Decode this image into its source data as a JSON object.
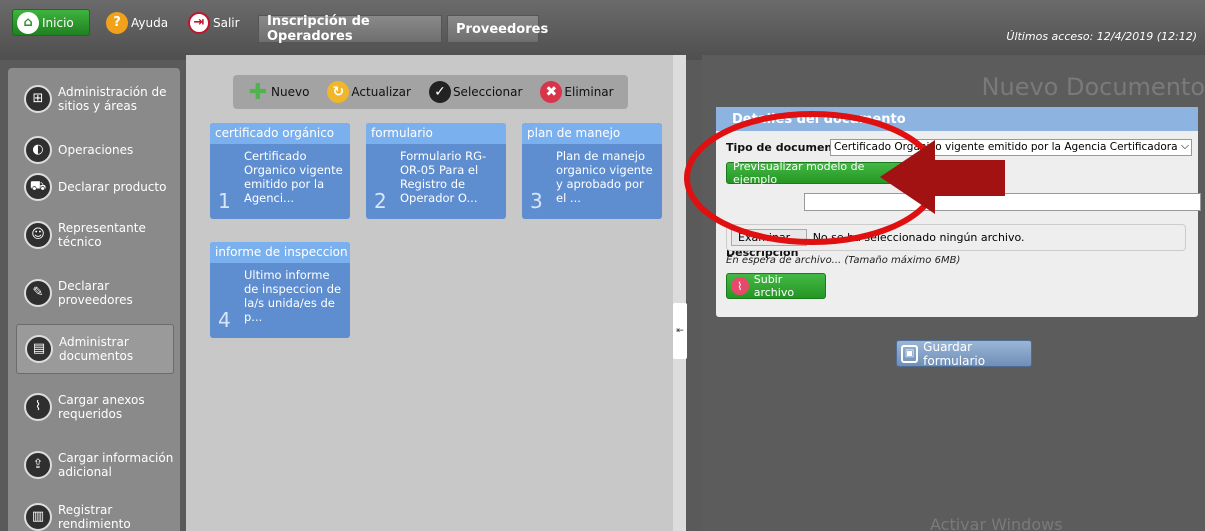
{
  "topbar": {
    "inicio_label": "Inicio",
    "ayuda_label": "Ayuda",
    "salir_label": "Salir",
    "tabs": [
      {
        "label": "Inscripción de Operadores"
      },
      {
        "label": "Proveedores"
      }
    ],
    "last_access": "Últimos acceso: 12/4/2019 (12:12)"
  },
  "sidebar": {
    "items": [
      {
        "label": "Administración de sitios y áreas",
        "icon": "sitemap-icon"
      },
      {
        "label": "Operaciones",
        "icon": "operations-icon"
      },
      {
        "label": "Declarar producto",
        "icon": "cart-icon"
      },
      {
        "label": "Representante técnico",
        "icon": "user-icon"
      },
      {
        "label": "Declarar proveedores",
        "icon": "supplier-icon"
      },
      {
        "label": "Administrar documentos",
        "icon": "documents-icon"
      },
      {
        "label": "Cargar anexos requeridos",
        "icon": "attachment-icon"
      },
      {
        "label": "Cargar información adicional",
        "icon": "upload-icon"
      },
      {
        "label": "Registrar rendimiento",
        "icon": "chart-icon"
      }
    ]
  },
  "toolbar": {
    "nuevo": "Nuevo",
    "actualizar": "Actualizar",
    "seleccionar": "Seleccionar",
    "eliminar": "Eliminar"
  },
  "cards": [
    {
      "num": "1",
      "title": "certificado orgánico",
      "text": "Certificado Organico vigente emitido por la Agenci..."
    },
    {
      "num": "2",
      "title": "formulario",
      "text": "Formulario RG-OR-05 Para el Registro de Operador O..."
    },
    {
      "num": "3",
      "title": "plan de manejo",
      "text": "Plan de manejo organico vigente y aprobado por el ..."
    },
    {
      "num": "4",
      "title": "informe de inspeccion",
      "text": "Ultimo informe de inspeccion de la/s unida/es de p..."
    }
  ],
  "panel": {
    "title": "Nuevo Documento",
    "details_header": "Detalles del documento",
    "tipo_label": "Tipo de documento",
    "tipo_value": "Certificado Organico vigente emitido por la Agencia Certificadora y la l",
    "preview_btn": "Previsualizar modelo de ejemplo",
    "descripcion_label": "Descripción",
    "descripcion_value": "",
    "examinar_btn": "Examinar...",
    "no_file": "No se ha seleccionado ningún archivo.",
    "waiting": "En espera de archivo... (Tamaño máximo 6MB)",
    "upload_btn": "Subir archivo",
    "save_btn": "Guardar formulario",
    "watermark": "Activar Windows"
  }
}
